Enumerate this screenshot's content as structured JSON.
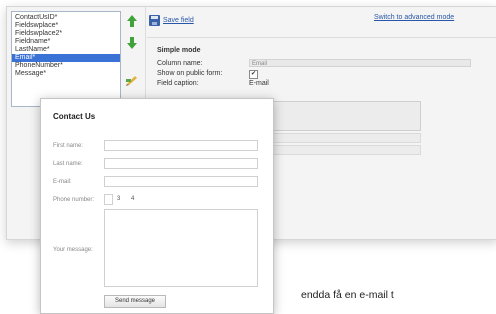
{
  "editor": {
    "field_list": [
      "ContactUsID*",
      "Fieldswplace*",
      "Fieldswplace2*",
      "Fieldname*",
      "LastName*",
      "Email*",
      "PhoneNumber*",
      "Message*"
    ],
    "selected_index": 5,
    "toolbar": {
      "save_label": "Save field",
      "advanced_link": "Switch to advanced mode"
    },
    "simple_mode": {
      "title": "Simple mode",
      "rows": [
        {
          "label": "Column name:",
          "value": "Email"
        },
        {
          "label": "Show on public form:",
          "checked": true
        },
        {
          "label": "Field caption:",
          "value": "E-mail"
        }
      ]
    },
    "icons": {
      "up": "arrow-up-icon",
      "down": "arrow-down-icon",
      "edit": "edit-pencil-icon",
      "save": "floppy-disk-icon"
    },
    "accent_colors": {
      "selection": "#3a72d6",
      "arrow": "#3fa23a",
      "link": "#2856a8"
    }
  },
  "contact_form": {
    "title": "Contact Us",
    "fields": [
      {
        "label": "First name:"
      },
      {
        "label": "Last name:"
      },
      {
        "label": "E-mail:"
      },
      {
        "label": "Phone number:"
      }
    ],
    "phone_prefix": "3",
    "phone_suffix": "4",
    "message_label": "Your message:",
    "send_label": "Send message"
  },
  "body_text": "endda få en e-mail t"
}
